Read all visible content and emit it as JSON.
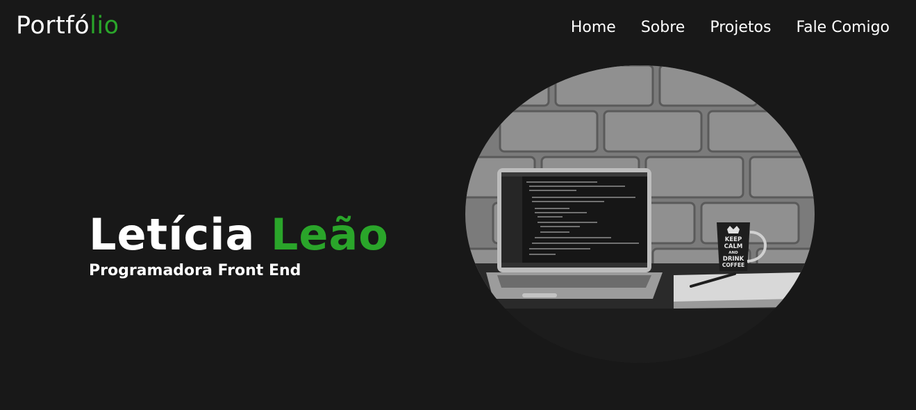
{
  "header": {
    "logo_main": "Portfó",
    "logo_accent": "lio",
    "nav": [
      {
        "label": "Home"
      },
      {
        "label": "Sobre"
      },
      {
        "label": "Projetos"
      },
      {
        "label": "Fale Comigo"
      }
    ]
  },
  "hero": {
    "first_name": "Letícia",
    "last_name": "Leão",
    "role": "Programadora Front End"
  },
  "mug": {
    "line1": "KEEP",
    "line2": "CALM",
    "line3": "AND",
    "line4": "DRINK",
    "line5": "COFFEE"
  },
  "colors": {
    "background": "#181818",
    "accent": "#2aa52a",
    "text": "#ffffff"
  },
  "icons": [
    "crown-icon"
  ]
}
